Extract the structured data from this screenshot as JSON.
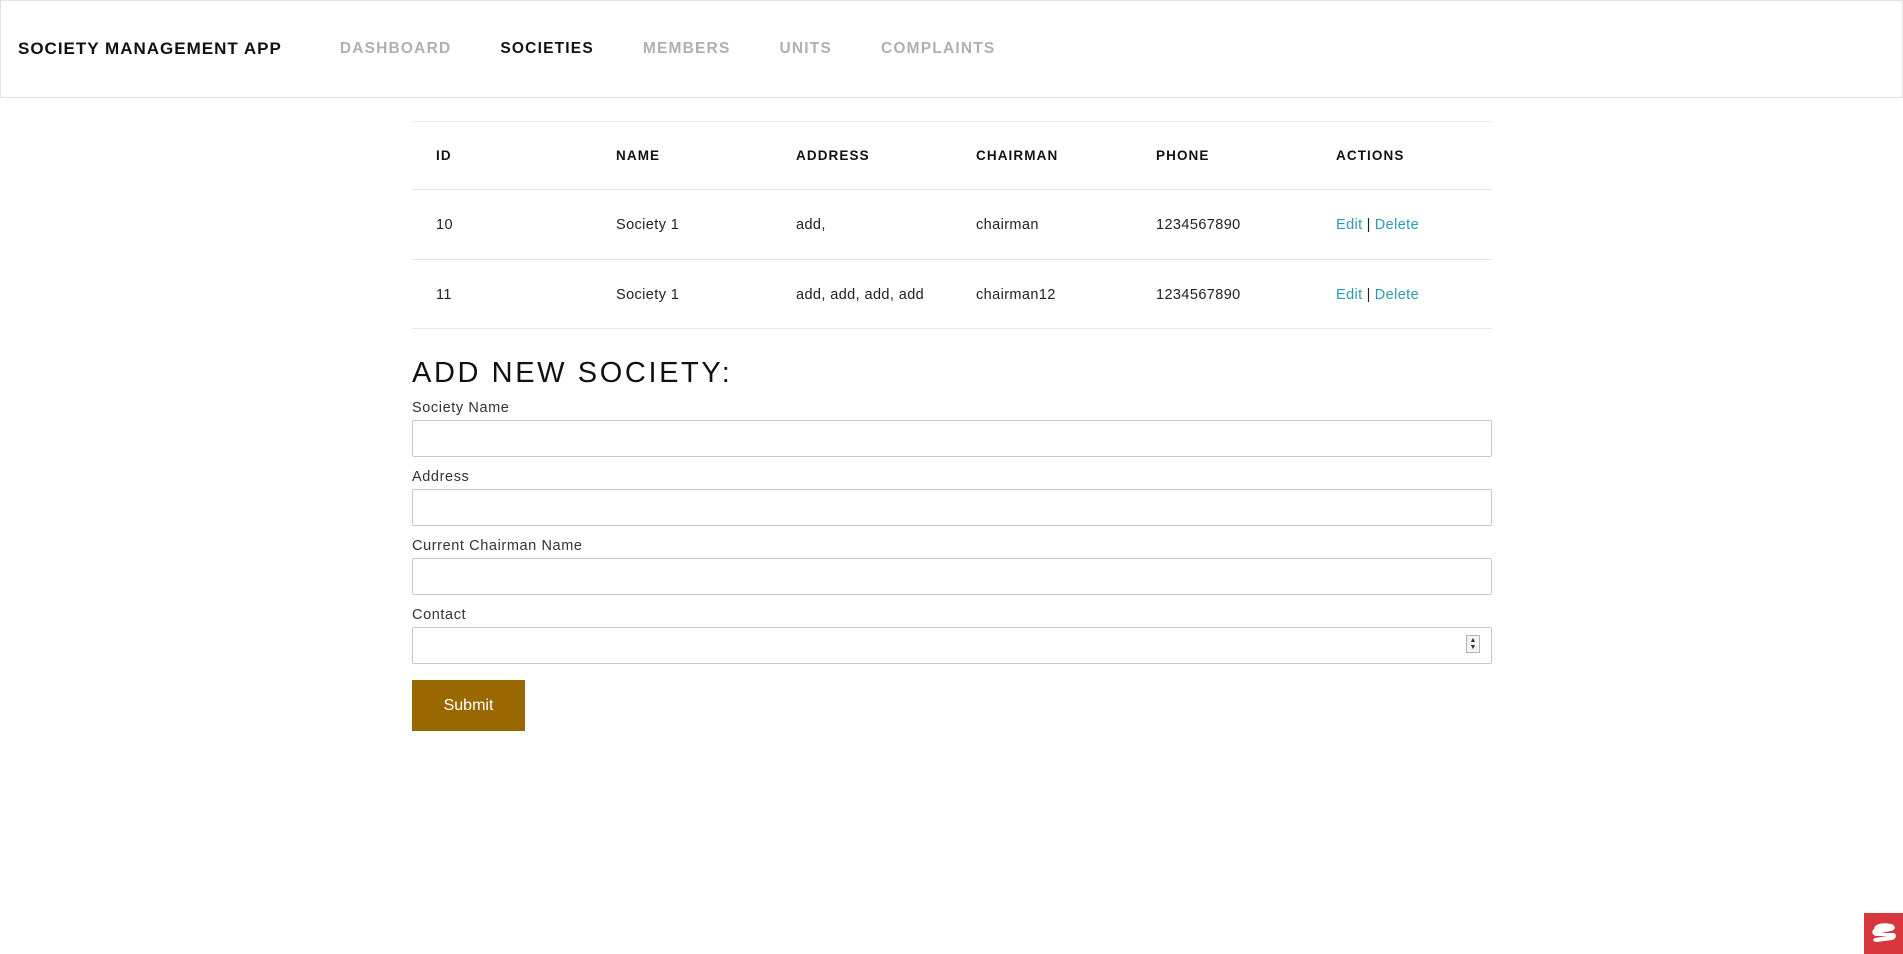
{
  "navbar": {
    "brand": "SOCIETY MANAGEMENT APP",
    "items": [
      {
        "label": "DASHBOARD",
        "active": false
      },
      {
        "label": "SOCIETIES",
        "active": true
      },
      {
        "label": "MEMBERS",
        "active": false
      },
      {
        "label": "UNITS",
        "active": false
      },
      {
        "label": "COMPLAINTS",
        "active": false
      }
    ]
  },
  "table": {
    "headers": [
      "ID",
      "NAME",
      "ADDRESS",
      "CHAIRMAN",
      "PHONE",
      "ACTIONS"
    ],
    "rows": [
      {
        "id": "10",
        "name": "Society 1",
        "address": "add,",
        "chairman": "chairman",
        "phone": "1234567890"
      },
      {
        "id": "11",
        "name": "Society 1",
        "address": "add, add, add, add",
        "chairman": "chairman12",
        "phone": "1234567890"
      }
    ],
    "actions": {
      "edit": "Edit",
      "separator": "|",
      "delete": "Delete"
    }
  },
  "form": {
    "title": "ADD NEW SOCIETY:",
    "fields": [
      {
        "label": "Society Name",
        "value": ""
      },
      {
        "label": "Address",
        "value": ""
      },
      {
        "label": "Current Chairman Name",
        "value": ""
      },
      {
        "label": "Contact",
        "value": ""
      }
    ],
    "submit_label": "Submit"
  },
  "colors": {
    "accent_link": "#2a9db3",
    "submit_bg": "#9a6800",
    "nav_inactive": "#b0b0b0",
    "corner_widget": "#d7363d"
  },
  "icons": {
    "corner_widget": "chat-widget-icon",
    "contact_spinner": "number-spinner-icon"
  }
}
